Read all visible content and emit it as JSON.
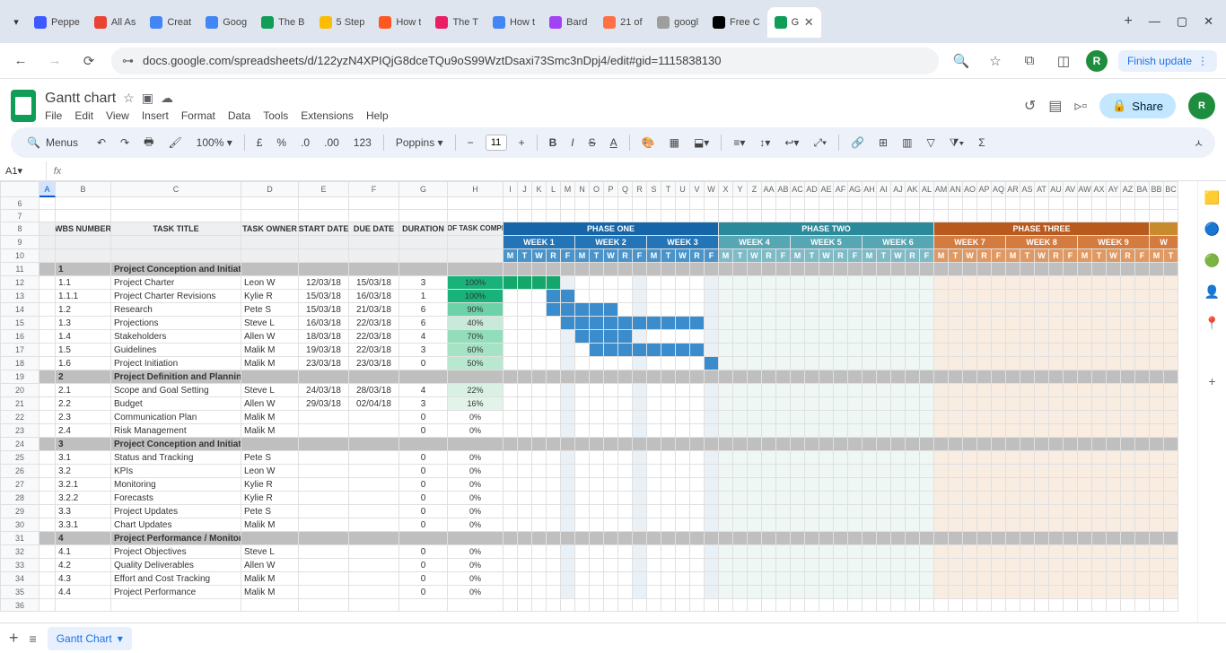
{
  "browser": {
    "tabs": [
      {
        "label": "Peppe",
        "fav": "#3d5afe"
      },
      {
        "label": "All As",
        "fav": "#ea4335"
      },
      {
        "label": "Creat",
        "fav": "#4285f4"
      },
      {
        "label": "Goog",
        "fav": "#4285f4"
      },
      {
        "label": "The B",
        "fav": "#0f9d58"
      },
      {
        "label": "5 Step",
        "fav": "#fbbc04"
      },
      {
        "label": "How t",
        "fav": "#ff5722"
      },
      {
        "label": "The T",
        "fav": "#e91e63"
      },
      {
        "label": "How t",
        "fav": "#4285f4"
      },
      {
        "label": "Bard",
        "fav": "#a142f4"
      },
      {
        "label": "21 of",
        "fav": "#ff7043"
      },
      {
        "label": "googl",
        "fav": "#9e9e9e"
      },
      {
        "label": "Free C",
        "fav": "#000"
      },
      {
        "label": "G",
        "fav": "#0f9d58",
        "active": true
      }
    ],
    "url": "docs.google.com/spreadsheets/d/122yzN4XPIQjG8dceTQu9oS99WztDsaxi73Smc3nDpj4/edit#gid=1115838130",
    "finish": "Finish update",
    "avatar": "R"
  },
  "doc": {
    "name": "Gantt chart",
    "menus": [
      "File",
      "Edit",
      "View",
      "Insert",
      "Format",
      "Data",
      "Tools",
      "Extensions",
      "Help"
    ],
    "share": "Share",
    "avatar": "R"
  },
  "toolbar": {
    "menus": "Menus",
    "zoom": "100%",
    "font": "Poppins",
    "fsize": "11"
  },
  "fx": {
    "cell": "A1"
  },
  "cols": [
    "A",
    "B",
    "C",
    "D",
    "E",
    "F",
    "G",
    "H",
    "I",
    "J",
    "K",
    "L",
    "M",
    "N",
    "O",
    "P",
    "Q",
    "R",
    "S",
    "T",
    "U",
    "V",
    "W",
    "X",
    "Y",
    "Z",
    "AA",
    "AB",
    "AC",
    "AD",
    "AE",
    "AF",
    "AG",
    "AH",
    "AI",
    "AJ",
    "AK",
    "AL",
    "AM",
    "AN",
    "AO",
    "AP",
    "AQ",
    "AR",
    "AS",
    "AT",
    "AU",
    "AV",
    "AW",
    "AX",
    "AY",
    "AZ",
    "BA",
    "BB",
    "BC"
  ],
  "headers": {
    "wbs": "WBS NUMBER",
    "title": "TASK TITLE",
    "owner": "TASK OWNER",
    "start": "START DATE",
    "due": "DUE DATE",
    "dur": "DURATION",
    "pct": "PCT OF TASK COMPLETE"
  },
  "phases": [
    {
      "label": "PHASE ONE",
      "color": "#1565a8"
    },
    {
      "label": "PHASE TWO",
      "color": "#2b8a99"
    },
    {
      "label": "PHASE THREE",
      "color": "#b85a1e"
    }
  ],
  "weeks": [
    "WEEK 1",
    "WEEK 2",
    "WEEK 3",
    "WEEK 4",
    "WEEK 5",
    "WEEK 6",
    "WEEK 7",
    "WEEK 8",
    "WEEK 9"
  ],
  "days": [
    "M",
    "T",
    "W",
    "R",
    "F"
  ],
  "rows": [
    {
      "n": 6,
      "type": "empty"
    },
    {
      "n": 7,
      "type": "empty"
    },
    {
      "n": 8,
      "type": "hdr1"
    },
    {
      "n": 9,
      "type": "hdr2"
    },
    {
      "n": 10,
      "type": "hdr3"
    },
    {
      "n": 11,
      "type": "section",
      "wbs": "1",
      "title": "Project Conception and Initiation"
    },
    {
      "n": 12,
      "type": "task",
      "wbs": "1.1",
      "title": "Project Charter",
      "owner": "Leon W",
      "start": "12/03/18",
      "due": "15/03/18",
      "dur": "3",
      "pct": "100%",
      "pcolor": "#18b37a",
      "bar": [
        0,
        1,
        2,
        3
      ],
      "done": true
    },
    {
      "n": 13,
      "type": "task",
      "wbs": "1.1.1",
      "title": "Project Charter Revisions",
      "owner": "Kylie R",
      "start": "15/03/18",
      "due": "16/03/18",
      "dur": "1",
      "pct": "100%",
      "pcolor": "#18b37a",
      "bar": [
        3,
        4
      ]
    },
    {
      "n": 14,
      "type": "task",
      "wbs": "1.2",
      "title": "Research",
      "owner": "Pete S",
      "start": "15/03/18",
      "due": "21/03/18",
      "dur": "6",
      "pct": "90%",
      "pcolor": "#6dd2a8",
      "bar": [
        3,
        4,
        5,
        6,
        7
      ]
    },
    {
      "n": 15,
      "type": "task",
      "wbs": "1.3",
      "title": "Projections",
      "owner": "Steve L",
      "start": "16/03/18",
      "due": "22/03/18",
      "dur": "6",
      "pct": "40%",
      "pcolor": "#c9e9da",
      "bar": [
        4,
        5,
        6,
        7,
        8,
        9,
        10,
        11,
        12,
        13
      ]
    },
    {
      "n": 16,
      "type": "task",
      "wbs": "1.4",
      "title": "Stakeholders",
      "owner": "Allen W",
      "start": "18/03/18",
      "due": "22/03/18",
      "dur": "4",
      "pct": "70%",
      "pcolor": "#92deba",
      "bar": [
        5,
        6,
        7,
        8
      ]
    },
    {
      "n": 17,
      "type": "task",
      "wbs": "1.5",
      "title": "Guidelines",
      "owner": "Malik M",
      "start": "19/03/18",
      "due": "22/03/18",
      "dur": "3",
      "pct": "60%",
      "pcolor": "#a6e3c5",
      "bar": [
        6,
        7,
        8,
        9,
        10,
        11,
        12,
        13
      ]
    },
    {
      "n": 18,
      "type": "task",
      "wbs": "1.6",
      "title": "Project Initiation",
      "owner": "Malik M",
      "start": "23/03/18",
      "due": "23/03/18",
      "dur": "0",
      "pct": "50%",
      "pcolor": "#b8e9d0",
      "bar": [
        14
      ]
    },
    {
      "n": 19,
      "type": "section",
      "wbs": "2",
      "title": "Project Definition and Planning"
    },
    {
      "n": 20,
      "type": "task",
      "wbs": "2.1",
      "title": "Scope and Goal Setting",
      "owner": "Steve L",
      "start": "24/03/18",
      "due": "28/03/18",
      "dur": "4",
      "pct": "22%",
      "pcolor": "#d9f0e5",
      "bar": []
    },
    {
      "n": 21,
      "type": "task",
      "wbs": "2.2",
      "title": "Budget",
      "owner": "Allen W",
      "start": "29/03/18",
      "due": "02/04/18",
      "dur": "3",
      "pct": "16%",
      "pcolor": "#e2f3ea",
      "bar": []
    },
    {
      "n": 22,
      "type": "task",
      "wbs": "2.3",
      "title": "Communication Plan",
      "owner": "Malik M",
      "start": "",
      "due": "",
      "dur": "0",
      "pct": "0%",
      "pcolor": "#fff",
      "bar": []
    },
    {
      "n": 23,
      "type": "task",
      "wbs": "2.4",
      "title": "Risk Management",
      "owner": "Malik M",
      "start": "",
      "due": "",
      "dur": "0",
      "pct": "0%",
      "pcolor": "#fff",
      "bar": []
    },
    {
      "n": 24,
      "type": "section",
      "wbs": "3",
      "title": "Project Conception and Initiation"
    },
    {
      "n": 25,
      "type": "task",
      "wbs": "3.1",
      "title": "Status and Tracking",
      "owner": "Pete S",
      "start": "",
      "due": "",
      "dur": "0",
      "pct": "0%",
      "pcolor": "#fff",
      "bar": []
    },
    {
      "n": 26,
      "type": "task",
      "wbs": "3.2",
      "title": "KPIs",
      "owner": "Leon W",
      "start": "",
      "due": "",
      "dur": "0",
      "pct": "0%",
      "pcolor": "#fff",
      "bar": []
    },
    {
      "n": 27,
      "type": "task",
      "wbs": "3.2.1",
      "title": "Monitoring",
      "owner": "Kylie R",
      "start": "",
      "due": "",
      "dur": "0",
      "pct": "0%",
      "pcolor": "#fff",
      "bar": []
    },
    {
      "n": 28,
      "type": "task",
      "wbs": "3.2.2",
      "title": "Forecasts",
      "owner": "Kylie R",
      "start": "",
      "due": "",
      "dur": "0",
      "pct": "0%",
      "pcolor": "#fff",
      "bar": []
    },
    {
      "n": 29,
      "type": "task",
      "wbs": "3.3",
      "title": "Project Updates",
      "owner": "Pete S",
      "start": "",
      "due": "",
      "dur": "0",
      "pct": "0%",
      "pcolor": "#fff",
      "bar": []
    },
    {
      "n": 30,
      "type": "task",
      "wbs": "3.3.1",
      "title": "Chart Updates",
      "owner": "Malik M",
      "start": "",
      "due": "",
      "dur": "0",
      "pct": "0%",
      "pcolor": "#fff",
      "bar": []
    },
    {
      "n": 31,
      "type": "section",
      "wbs": "4",
      "title": "Project Performance / Monitoring"
    },
    {
      "n": 32,
      "type": "task",
      "wbs": "4.1",
      "title": "Project Objectives",
      "owner": "Steve L",
      "start": "",
      "due": "",
      "dur": "0",
      "pct": "0%",
      "pcolor": "#fff",
      "bar": []
    },
    {
      "n": 33,
      "type": "task",
      "wbs": "4.2",
      "title": "Quality Deliverables",
      "owner": "Allen W",
      "start": "",
      "due": "",
      "dur": "0",
      "pct": "0%",
      "pcolor": "#fff",
      "bar": []
    },
    {
      "n": 34,
      "type": "task",
      "wbs": "4.3",
      "title": "Effort and Cost Tracking",
      "owner": "Malik M",
      "start": "",
      "due": "",
      "dur": "0",
      "pct": "0%",
      "pcolor": "#fff",
      "bar": []
    },
    {
      "n": 35,
      "type": "task",
      "wbs": "4.4",
      "title": "Project Performance",
      "owner": "Malik M",
      "start": "",
      "due": "",
      "dur": "0",
      "pct": "0%",
      "pcolor": "#fff",
      "bar": []
    },
    {
      "n": 36,
      "type": "empty-end"
    }
  ],
  "sheet_tab": "Gantt Chart",
  "week_colors": [
    "#2375b8",
    "#2375b8",
    "#2375b8",
    "#57a6b4",
    "#57a6b4",
    "#57a6b4",
    "#d47b3f",
    "#d47b3f",
    "#d47b3f"
  ],
  "day_colors": [
    "#4b94ca",
    "#4b94ca",
    "#4b94ca",
    "#7fbbc6",
    "#7fbbc6",
    "#7fbbc6",
    "#e09962",
    "#e09962",
    "#e09962"
  ]
}
